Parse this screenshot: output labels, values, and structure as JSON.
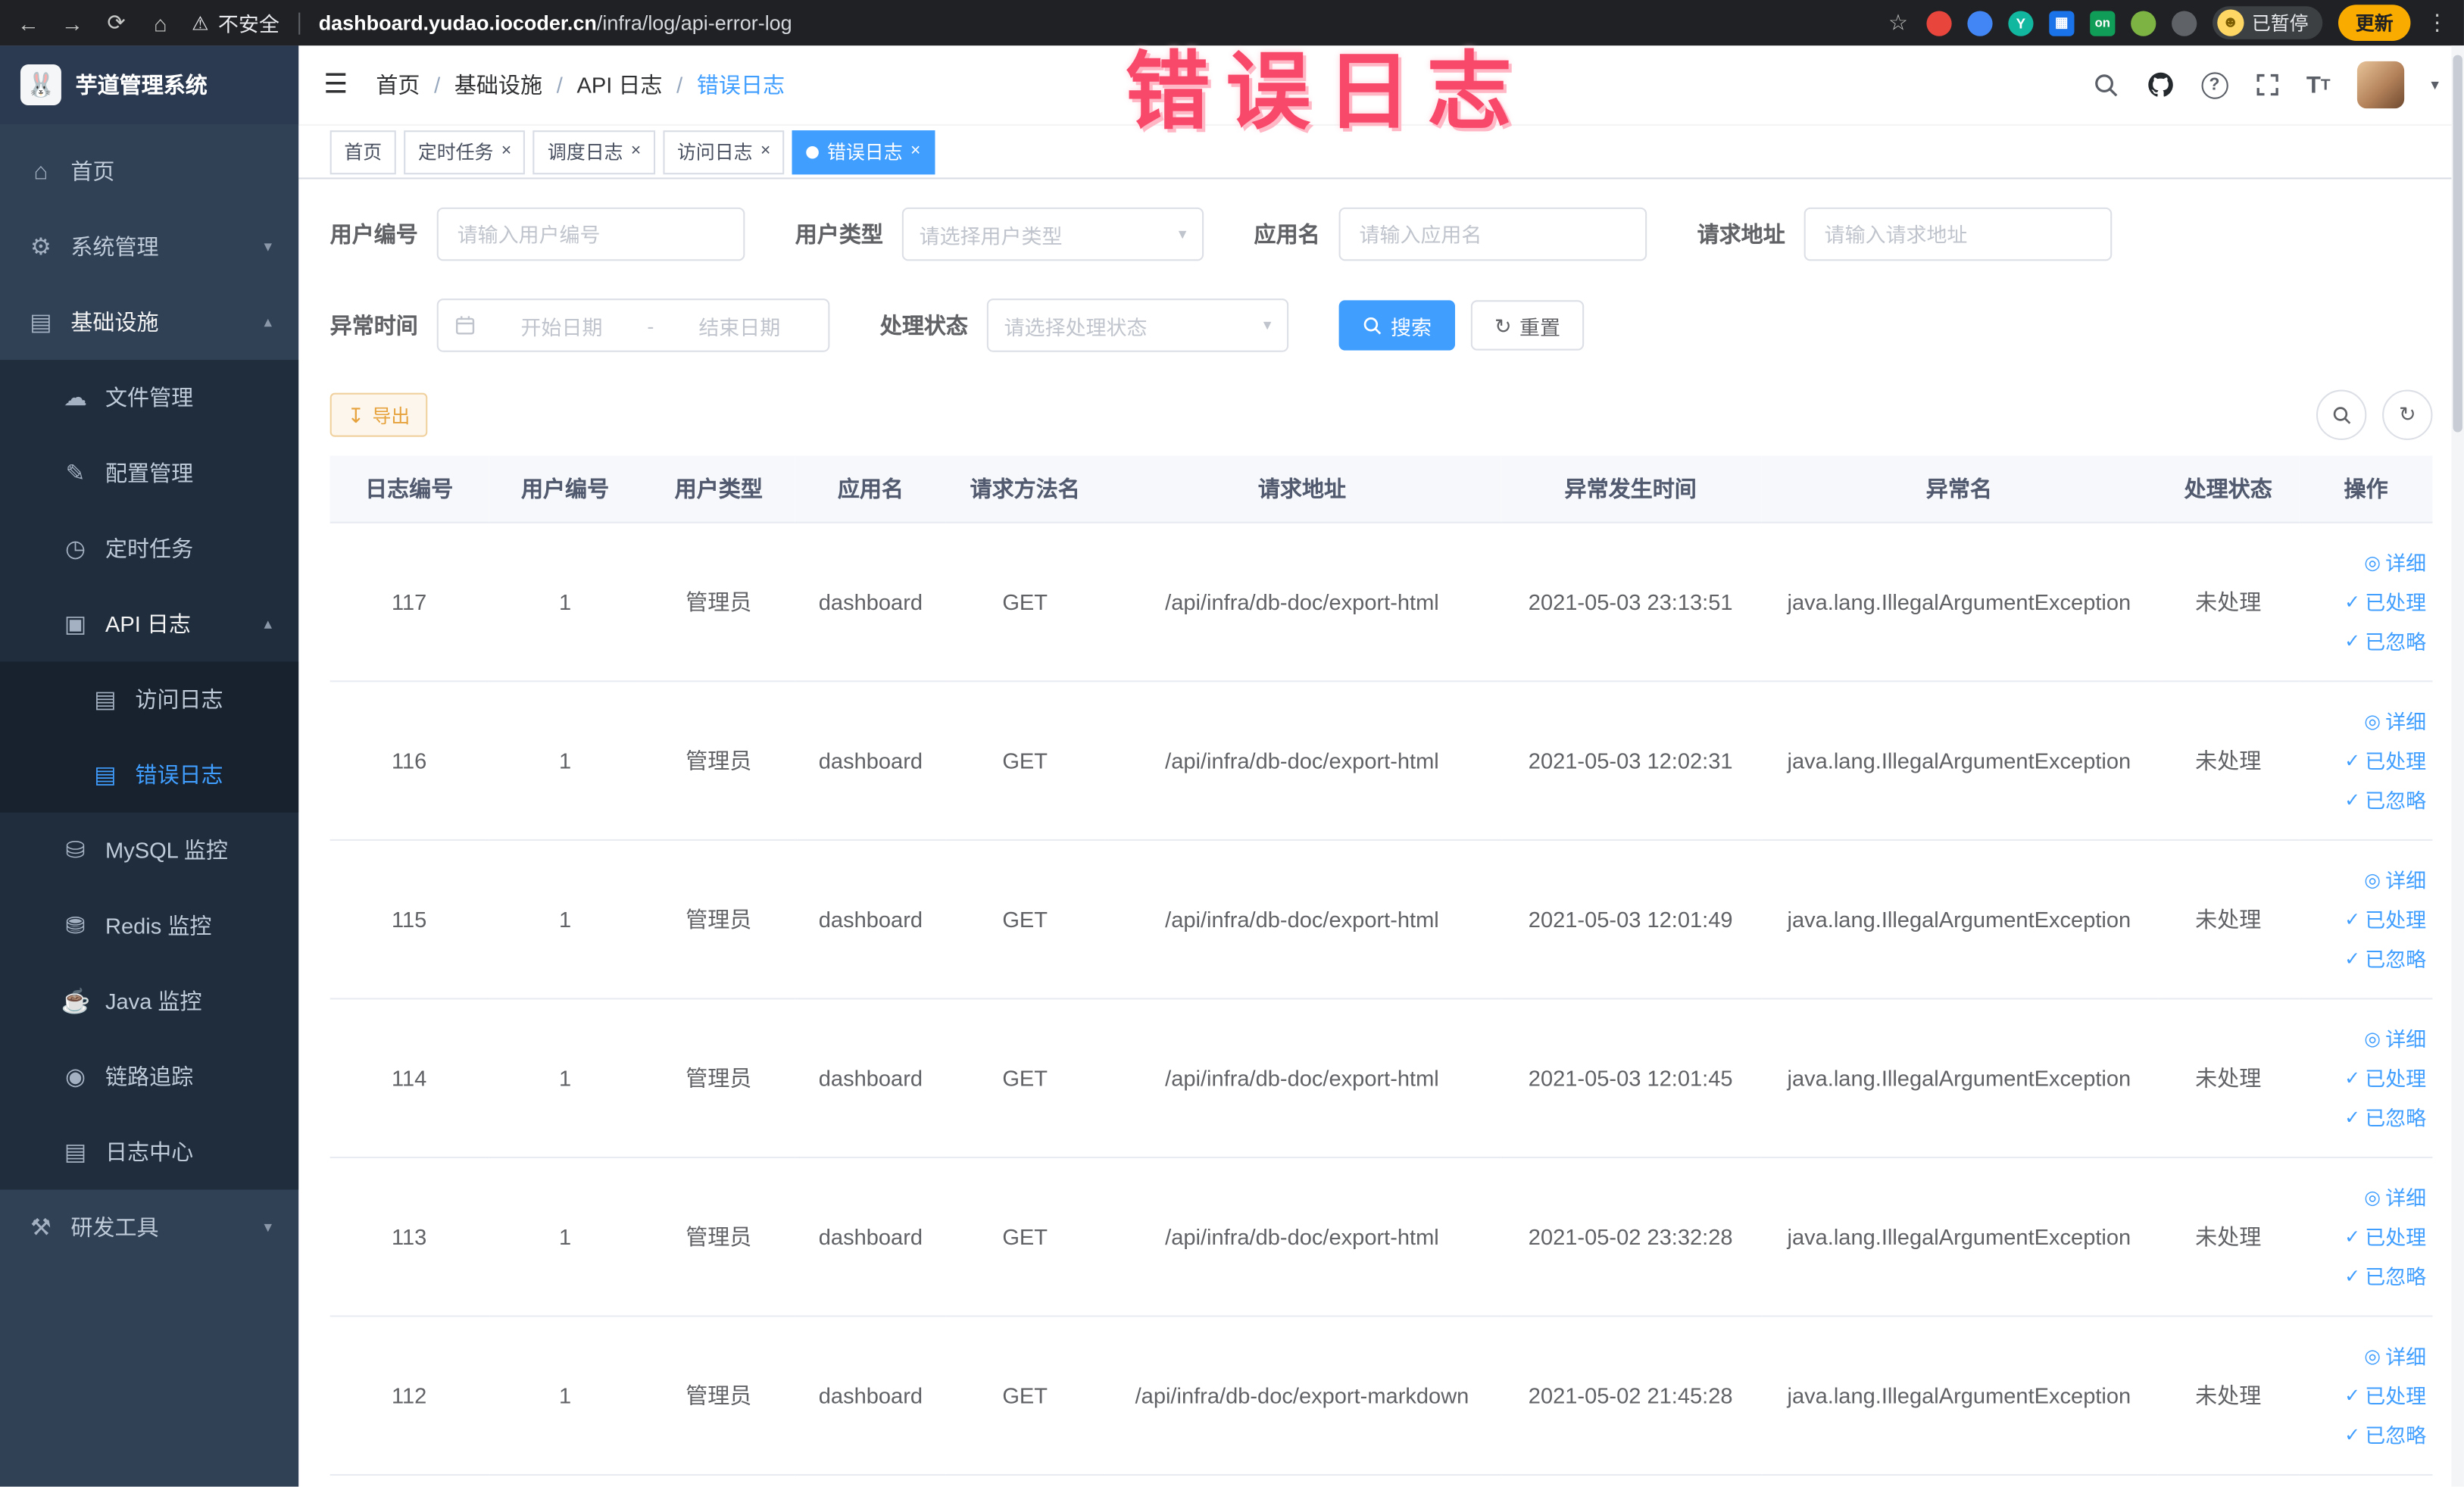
{
  "browser": {
    "security_text": "不安全",
    "url_domain": "dashboard.yudao.iocoder.cn",
    "url_path": "/infra/log/api-error-log",
    "ext_y": "Y",
    "ext_on": "on",
    "profile_chip": "已暂停",
    "update_button": "更新"
  },
  "icons": {
    "back": "←",
    "forward": "→",
    "reload": "⟳",
    "home": "⌂",
    "warning": "⚠",
    "star": "☆",
    "more": "⋮",
    "grid": "▦",
    "puzzle": "⚩",
    "face": "☻",
    "hamburger": "☰",
    "menu_home": "⌂",
    "menu_system": "⚙",
    "menu_infra": "▤",
    "menu_file": "☁",
    "menu_config": "✎",
    "menu_job": "◷",
    "menu_apilog": "▣",
    "menu_accesslog": "▤",
    "menu_errorlog": "▤",
    "menu_mysql": "⛁",
    "menu_redis": "⛃",
    "menu_java": "☕",
    "menu_trace": "◉",
    "menu_logcenter": "▤",
    "menu_devtools": "⚒",
    "chevron_down": "▾",
    "chevron_up": "▴",
    "caret_down": "▾",
    "question": "?",
    "t_large": "T",
    "t_small": "T",
    "refresh": "↻",
    "export": "↧",
    "close": "×",
    "dot": "●",
    "detail": "◎",
    "check": "✓",
    "range_separator": "-"
  },
  "sidebar": {
    "logo": "芋道管理系统",
    "items": [
      "首页",
      "系统管理",
      "基础设施",
      "文件管理",
      "配置管理",
      "定时任务",
      "API 日志",
      "访问日志",
      "错误日志",
      "MySQL 监控",
      "Redis 监控",
      "Java 监控",
      "链路追踪",
      "日志中心",
      "研发工具"
    ]
  },
  "header": {
    "breadcrumb": [
      "首页",
      "基础设施",
      "API 日志",
      "错误日志"
    ],
    "separator": "/"
  },
  "annotation": {
    "text": "错误日志"
  },
  "tabs": [
    {
      "label": "首页"
    },
    {
      "label": "定时任务"
    },
    {
      "label": "调度日志"
    },
    {
      "label": "访问日志"
    },
    {
      "label": "错误日志"
    }
  ],
  "filters": {
    "user_id_label": "用户编号",
    "user_id_placeholder": "请输入用户编号",
    "user_type_label": "用户类型",
    "user_type_placeholder": "请选择用户类型",
    "app_name_label": "应用名",
    "app_name_placeholder": "请输入应用名",
    "request_url_label": "请求地址",
    "request_url_placeholder": "请输入请求地址",
    "time_label": "异常时间",
    "time_start_placeholder": "开始日期",
    "time_end_placeholder": "结束日期",
    "status_label": "处理状态",
    "status_placeholder": "请选择处理状态",
    "search_button": "搜索",
    "reset_button": "重置"
  },
  "toolbar": {
    "export_button": "导出"
  },
  "table": {
    "columns": [
      "日志编号",
      "用户编号",
      "用户类型",
      "应用名",
      "请求方法名",
      "请求地址",
      "异常发生时间",
      "异常名",
      "处理状态",
      "操作"
    ],
    "action_labels": [
      "详细",
      "已处理",
      "已忽略"
    ],
    "rows": [
      {
        "log_id": "117",
        "user_id": "1",
        "user_type": "管理员",
        "app_name": "dashboard",
        "method": "GET",
        "url": "/api/infra/db-doc/export-html",
        "time": "2021-05-03 23:13:51",
        "exception": "java.lang.IllegalArgumentException",
        "status": "未处理"
      },
      {
        "log_id": "116",
        "user_id": "1",
        "user_type": "管理员",
        "app_name": "dashboard",
        "method": "GET",
        "url": "/api/infra/db-doc/export-html",
        "time": "2021-05-03 12:02:31",
        "exception": "java.lang.IllegalArgumentException",
        "status": "未处理"
      },
      {
        "log_id": "115",
        "user_id": "1",
        "user_type": "管理员",
        "app_name": "dashboard",
        "method": "GET",
        "url": "/api/infra/db-doc/export-html",
        "time": "2021-05-03 12:01:49",
        "exception": "java.lang.IllegalArgumentException",
        "status": "未处理"
      },
      {
        "log_id": "114",
        "user_id": "1",
        "user_type": "管理员",
        "app_name": "dashboard",
        "method": "GET",
        "url": "/api/infra/db-doc/export-html",
        "time": "2021-05-03 12:01:45",
        "exception": "java.lang.IllegalArgumentException",
        "status": "未处理"
      },
      {
        "log_id": "113",
        "user_id": "1",
        "user_type": "管理员",
        "app_name": "dashboard",
        "method": "GET",
        "url": "/api/infra/db-doc/export-html",
        "time": "2021-05-02 23:32:28",
        "exception": "java.lang.IllegalArgumentException",
        "status": "未处理"
      },
      {
        "log_id": "112",
        "user_id": "1",
        "user_type": "管理员",
        "app_name": "dashboard",
        "method": "GET",
        "url": "/api/infra/db-doc/export-markdown",
        "time": "2021-05-02 21:45:28",
        "exception": "java.lang.IllegalArgumentException",
        "status": "未处理"
      }
    ]
  }
}
